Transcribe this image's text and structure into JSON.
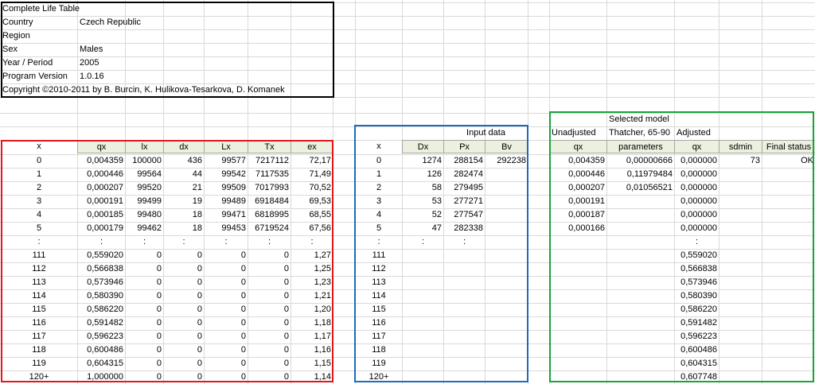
{
  "info": {
    "title": "Complete Life Table",
    "fields": [
      {
        "label": "Country",
        "value": "Czech Republic"
      },
      {
        "label": "Region",
        "value": ""
      },
      {
        "label": "Sex",
        "value": "Males"
      },
      {
        "label": "Year / Period",
        "value": "2005"
      },
      {
        "label": "Program Version",
        "value": "1.0.16"
      }
    ],
    "copyright": "Copyright ©2010-2011 by B. Burcin, K. Hulikova-Tesarkova, D. Komanek"
  },
  "life_table": {
    "headers": [
      "x",
      "qx",
      "lx",
      "dx",
      "Lx",
      "Tx",
      "ex"
    ],
    "rows": [
      [
        "0",
        "0,004359",
        "100000",
        "436",
        "99577",
        "7217112",
        "72,17"
      ],
      [
        "1",
        "0,000446",
        "99564",
        "44",
        "99542",
        "7117535",
        "71,49"
      ],
      [
        "2",
        "0,000207",
        "99520",
        "21",
        "99509",
        "7017993",
        "70,52"
      ],
      [
        "3",
        "0,000191",
        "99499",
        "19",
        "99489",
        "6918484",
        "69,53"
      ],
      [
        "4",
        "0,000185",
        "99480",
        "18",
        "99471",
        "6818995",
        "68,55"
      ],
      [
        "5",
        "0,000179",
        "99462",
        "18",
        "99453",
        "6719524",
        "67,56"
      ],
      [
        ":",
        ":",
        ":",
        ":",
        ":",
        ":",
        ":"
      ],
      [
        "111",
        "0,559020",
        "0",
        "0",
        "0",
        "0",
        "1,27"
      ],
      [
        "112",
        "0,566838",
        "0",
        "0",
        "0",
        "0",
        "1,25"
      ],
      [
        "113",
        "0,573946",
        "0",
        "0",
        "0",
        "0",
        "1,23"
      ],
      [
        "114",
        "0,580390",
        "0",
        "0",
        "0",
        "0",
        "1,21"
      ],
      [
        "115",
        "0,586220",
        "0",
        "0",
        "0",
        "0",
        "1,20"
      ],
      [
        "116",
        "0,591482",
        "0",
        "0",
        "0",
        "0",
        "1,18"
      ],
      [
        "117",
        "0,596223",
        "0",
        "0",
        "0",
        "0",
        "1,17"
      ],
      [
        "118",
        "0,600486",
        "0",
        "0",
        "0",
        "0",
        "1,16"
      ],
      [
        "119",
        "0,604315",
        "0",
        "0",
        "0",
        "0",
        "1,15"
      ],
      [
        "120+",
        "1,000000",
        "0",
        "0",
        "0",
        "0",
        "1,14"
      ]
    ]
  },
  "input_data": {
    "title": "Input data",
    "headers": [
      "x",
      "Dx",
      "Px",
      "Bv"
    ],
    "rows": [
      [
        "0",
        "1274",
        "288154",
        "292238"
      ],
      [
        "1",
        "126",
        "282474",
        ""
      ],
      [
        "2",
        "58",
        "279495",
        ""
      ],
      [
        "3",
        "53",
        "277271",
        ""
      ],
      [
        "4",
        "52",
        "277547",
        ""
      ],
      [
        "5",
        "47",
        "282338",
        ""
      ],
      [
        ":",
        ":",
        ":",
        ""
      ],
      [
        "111",
        "",
        "",
        ""
      ],
      [
        "112",
        "",
        "",
        ""
      ],
      [
        "113",
        "",
        "",
        ""
      ],
      [
        "114",
        "",
        "",
        ""
      ],
      [
        "115",
        "",
        "",
        ""
      ],
      [
        "116",
        "",
        "",
        ""
      ],
      [
        "117",
        "",
        "",
        ""
      ],
      [
        "118",
        "",
        "",
        ""
      ],
      [
        "119",
        "",
        "",
        ""
      ],
      [
        "120+",
        "",
        "",
        ""
      ]
    ]
  },
  "model": {
    "selected_model_label": "Selected model",
    "unadjusted_label": "Unadjusted",
    "model_name": "Thatcher, 65-90",
    "adjusted_label": "Adjusted",
    "headers": [
      "qx",
      "parameters",
      "qx",
      "sdmin",
      "Final status"
    ],
    "rows": [
      [
        "0,004359",
        "0,00000666",
        "0,000000",
        "73",
        "OK"
      ],
      [
        "0,000446",
        "0,11979484",
        "0,000000",
        "",
        ""
      ],
      [
        "0,000207",
        "0,01056521",
        "0,000000",
        "",
        ""
      ],
      [
        "0,000191",
        "",
        "0,000000",
        "",
        ""
      ],
      [
        "0,000187",
        "",
        "0,000000",
        "",
        ""
      ],
      [
        "0,000166",
        "",
        "0,000000",
        "",
        ""
      ],
      [
        "",
        "",
        ":",
        "",
        ""
      ],
      [
        "",
        "",
        "0,559020",
        "",
        ""
      ],
      [
        "",
        "",
        "0,566838",
        "",
        ""
      ],
      [
        "",
        "",
        "0,573946",
        "",
        ""
      ],
      [
        "",
        "",
        "0,580390",
        "",
        ""
      ],
      [
        "",
        "",
        "0,586220",
        "",
        ""
      ],
      [
        "",
        "",
        "0,591482",
        "",
        ""
      ],
      [
        "",
        "",
        "0,596223",
        "",
        ""
      ],
      [
        "",
        "",
        "0,600486",
        "",
        ""
      ],
      [
        "",
        "",
        "0,604315",
        "",
        ""
      ],
      [
        "",
        "",
        "0,607748",
        "",
        ""
      ]
    ]
  },
  "colors": {
    "header_fill": "#ebf1de",
    "info_box": "#000000",
    "life_table_box": "#e3161c",
    "input_box": "#1e6bb8",
    "model_box": "#1aa33a",
    "gridline": "#d9d9d9"
  }
}
